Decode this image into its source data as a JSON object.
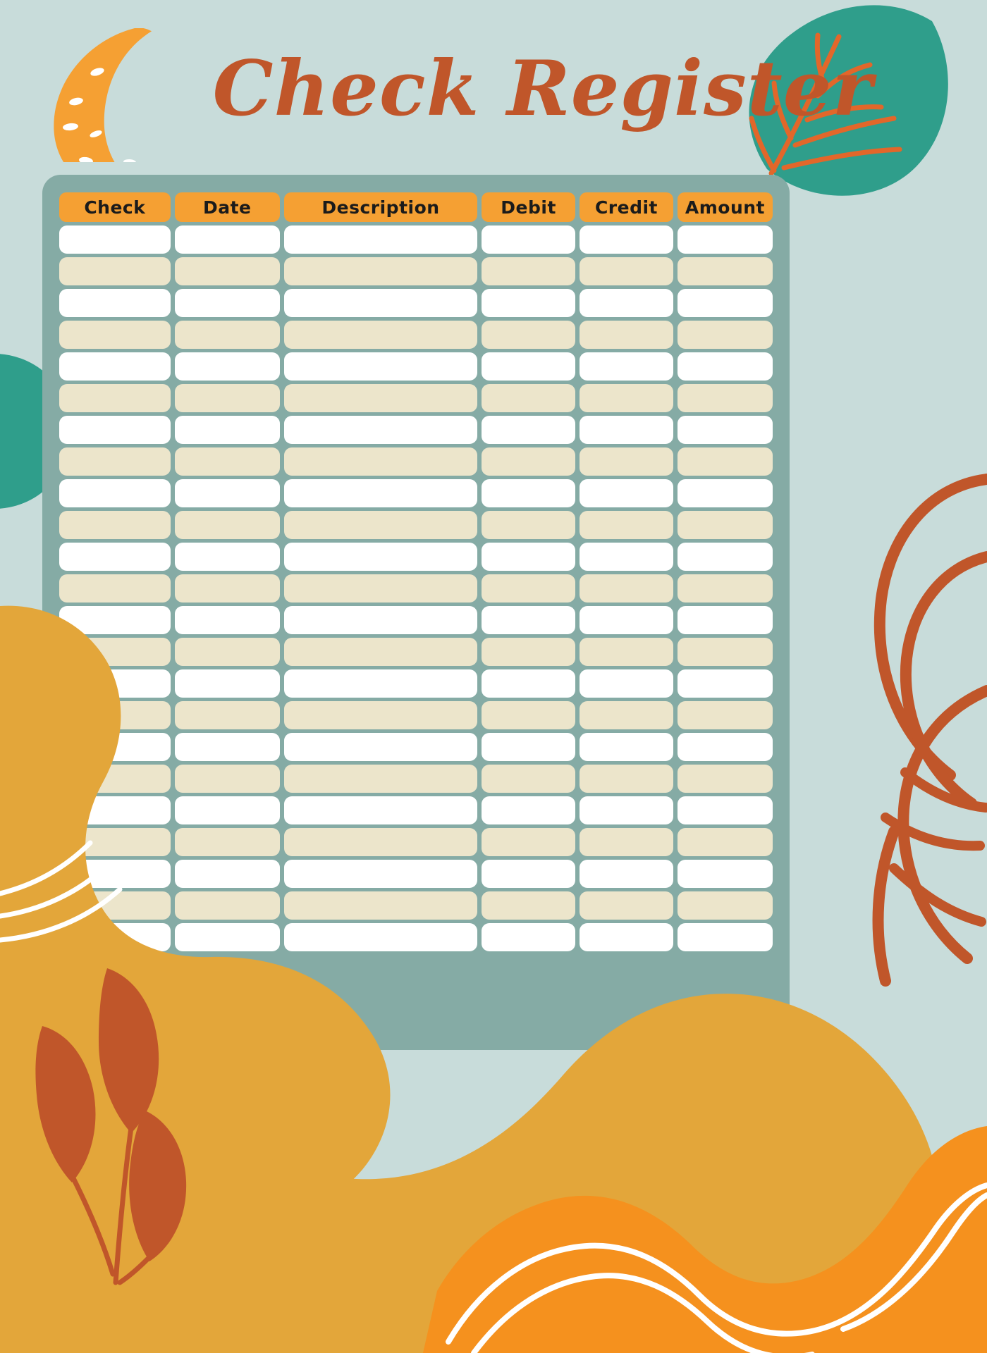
{
  "document": {
    "title": "Check Register"
  },
  "theme": {
    "background": "#c8dcda",
    "card": "#85aba5",
    "header_pill": "#f5a033",
    "title_text": "#c0562a",
    "row_white": "#ffffff",
    "row_cream": "#ece5cb",
    "leaf_teal": "#2f9e8b",
    "leaf_rust": "#c0562a",
    "blob_gold": "#e3a63a",
    "blob_orange": "#f5911e",
    "circle_teal": "#2f9e8b",
    "vein_orange": "#e2672a",
    "wave_white": "#ffffff"
  },
  "table": {
    "columns": [
      {
        "key": "check",
        "label": "Check"
      },
      {
        "key": "date",
        "label": "Date"
      },
      {
        "key": "description",
        "label": "Description"
      },
      {
        "key": "debit",
        "label": "Debit"
      },
      {
        "key": "credit",
        "label": "Credit"
      },
      {
        "key": "amount",
        "label": "Amount"
      }
    ],
    "row_count": 23,
    "rows": [
      {
        "check": "",
        "date": "",
        "description": "",
        "debit": "",
        "credit": "",
        "amount": ""
      },
      {
        "check": "",
        "date": "",
        "description": "",
        "debit": "",
        "credit": "",
        "amount": ""
      },
      {
        "check": "",
        "date": "",
        "description": "",
        "debit": "",
        "credit": "",
        "amount": ""
      },
      {
        "check": "",
        "date": "",
        "description": "",
        "debit": "",
        "credit": "",
        "amount": ""
      },
      {
        "check": "",
        "date": "",
        "description": "",
        "debit": "",
        "credit": "",
        "amount": ""
      },
      {
        "check": "",
        "date": "",
        "description": "",
        "debit": "",
        "credit": "",
        "amount": ""
      },
      {
        "check": "",
        "date": "",
        "description": "",
        "debit": "",
        "credit": "",
        "amount": ""
      },
      {
        "check": "",
        "date": "",
        "description": "",
        "debit": "",
        "credit": "",
        "amount": ""
      },
      {
        "check": "",
        "date": "",
        "description": "",
        "debit": "",
        "credit": "",
        "amount": ""
      },
      {
        "check": "",
        "date": "",
        "description": "",
        "debit": "",
        "credit": "",
        "amount": ""
      },
      {
        "check": "",
        "date": "",
        "description": "",
        "debit": "",
        "credit": "",
        "amount": ""
      },
      {
        "check": "",
        "date": "",
        "description": "",
        "debit": "",
        "credit": "",
        "amount": ""
      },
      {
        "check": "",
        "date": "",
        "description": "",
        "debit": "",
        "credit": "",
        "amount": ""
      },
      {
        "check": "",
        "date": "",
        "description": "",
        "debit": "",
        "credit": "",
        "amount": ""
      },
      {
        "check": "",
        "date": "",
        "description": "",
        "debit": "",
        "credit": "",
        "amount": ""
      },
      {
        "check": "",
        "date": "",
        "description": "",
        "debit": "",
        "credit": "",
        "amount": ""
      },
      {
        "check": "",
        "date": "",
        "description": "",
        "debit": "",
        "credit": "",
        "amount": ""
      },
      {
        "check": "",
        "date": "",
        "description": "",
        "debit": "",
        "credit": "",
        "amount": ""
      },
      {
        "check": "",
        "date": "",
        "description": "",
        "debit": "",
        "credit": "",
        "amount": ""
      },
      {
        "check": "",
        "date": "",
        "description": "",
        "debit": "",
        "credit": "",
        "amount": ""
      },
      {
        "check": "",
        "date": "",
        "description": "",
        "debit": "",
        "credit": "",
        "amount": ""
      },
      {
        "check": "",
        "date": "",
        "description": "",
        "debit": "",
        "credit": "",
        "amount": ""
      },
      {
        "check": "",
        "date": "",
        "description": "",
        "debit": "",
        "credit": "",
        "amount": ""
      }
    ]
  },
  "decorations": [
    {
      "name": "crescent-moon-icon",
      "position": "top-left"
    },
    {
      "name": "teal-leaf-icon",
      "position": "top-right"
    },
    {
      "name": "teal-circle-shape",
      "position": "left-middle"
    },
    {
      "name": "rust-branch-icon",
      "position": "right-middle"
    },
    {
      "name": "gold-blob-shape",
      "position": "bottom-left"
    },
    {
      "name": "rust-leaf-sprig-icon",
      "position": "bottom-left"
    },
    {
      "name": "orange-wave-blob-shape",
      "position": "bottom-right"
    }
  ]
}
